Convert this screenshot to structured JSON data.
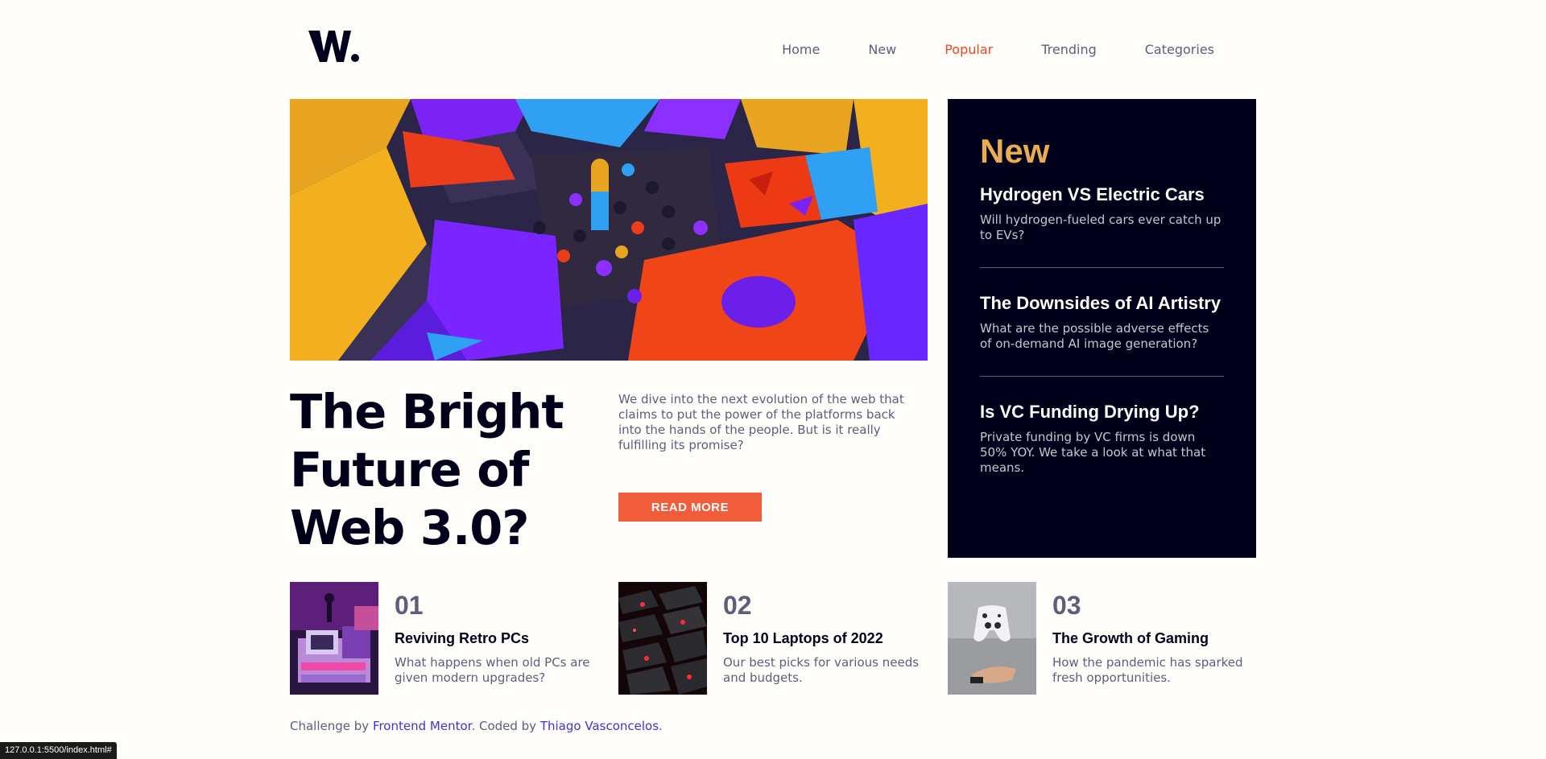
{
  "logo": {
    "icon": "w-logo-icon",
    "text": "W."
  },
  "nav": {
    "items": [
      {
        "label": "Home",
        "active": false
      },
      {
        "label": "New",
        "active": false
      },
      {
        "label": "Popular",
        "active": true
      },
      {
        "label": "Trending",
        "active": false
      },
      {
        "label": "Categories",
        "active": false
      }
    ],
    "active_color": "#e9471f"
  },
  "hero": {
    "title": "The Bright Future of Web 3.0?",
    "text": "We dive into the next evolution of the web that claims to put the power of the platforms back into the hands of the people. But is it really fulfilling its promise?",
    "button": "READ MORE"
  },
  "new_panel": {
    "heading": "New",
    "items": [
      {
        "title": "Hydrogen VS Electric Cars",
        "desc": "Will hydrogen-fueled cars ever catch up to EVs?"
      },
      {
        "title": "The Downsides of AI Artistry",
        "desc": "What are the possible adverse effects of on-demand AI image generation?"
      },
      {
        "title": "Is VC Funding Drying Up?",
        "desc": "Private funding by VC firms is down 50% YOY. We take a look at what that means."
      }
    ]
  },
  "articles": [
    {
      "num": "01",
      "title": "Reviving Retro PCs",
      "desc": "What happens when old PCs are given modern upgrades?"
    },
    {
      "num": "02",
      "title": "Top 10 Laptops of 2022",
      "desc": "Our best picks for various needs and budgets."
    },
    {
      "num": "03",
      "title": "The Growth of Gaming",
      "desc": "How the pandemic has sparked fresh opportunities."
    }
  ],
  "footer": {
    "prefix": "Challenge by ",
    "challenge_link": "Frontend Mentor",
    "middle": ". Coded by ",
    "author_link": "Thiago Vasconcelos",
    "suffix": "."
  },
  "status_url": "127.0.0.1:5500/index.html#",
  "colors": {
    "accent": "#f15d3a",
    "dark": "#00001a",
    "new_heading": "#e9ab53",
    "grey": "#5d5f79"
  }
}
